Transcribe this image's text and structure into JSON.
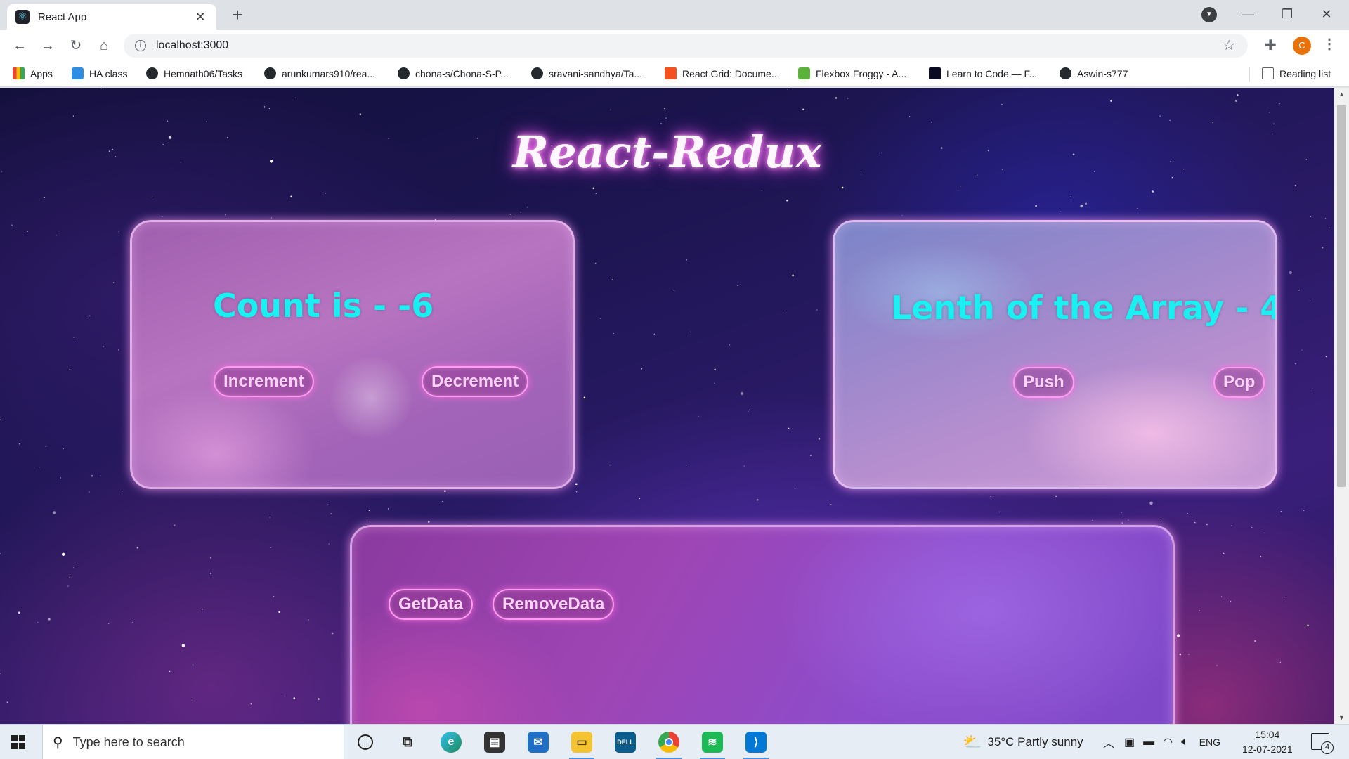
{
  "browser": {
    "tab_title": "React App",
    "url": "localhost:3000",
    "avatar_letter": "C",
    "bookmarks": [
      {
        "label": "Apps",
        "icon": "apps-grid-icon"
      },
      {
        "label": "HA class",
        "icon": "ha-class-icon"
      },
      {
        "label": "Hemnath06/Tasks",
        "icon": "github-icon"
      },
      {
        "label": "arunkumars910/rea...",
        "icon": "github-icon"
      },
      {
        "label": "chona-s/Chona-S-P...",
        "icon": "github-icon"
      },
      {
        "label": "sravani-sandhya/Ta...",
        "icon": "github-icon"
      },
      {
        "label": "React Grid: Docume...",
        "icon": "react-grid-icon"
      },
      {
        "label": "Flexbox Froggy - A...",
        "icon": "froggy-icon"
      },
      {
        "label": "Learn to Code — F...",
        "icon": "freecodecamp-icon"
      },
      {
        "label": "Aswin-s777",
        "icon": "github-icon"
      }
    ],
    "reading_list": "Reading list"
  },
  "page": {
    "title": "React-Redux",
    "counter": {
      "heading": "Count is - -6",
      "increment_label": "Increment",
      "decrement_label": "Decrement"
    },
    "array": {
      "heading": "Lenth of the Array - 4",
      "push_label": "Push",
      "pop_label": "Pop"
    },
    "data": {
      "get_label": "GetData",
      "remove_label": "RemoveData"
    }
  },
  "taskbar": {
    "search_placeholder": "Type here to search",
    "weather": "35°C  Partly sunny",
    "language": "ENG",
    "time": "15:04",
    "date": "12-07-2021",
    "notification_count": "4",
    "pinned_apps": [
      "cortana-icon",
      "task-view-icon",
      "edge-icon",
      "store-icon",
      "mail-icon",
      "file-explorer-icon",
      "dell-icon",
      "chrome-icon",
      "spotify-icon",
      "vscode-icon"
    ]
  },
  "colors": {
    "heading_cyan": "#18f0f2",
    "button_border": "#ff9cf0",
    "title_glow": "#e35ce0"
  }
}
